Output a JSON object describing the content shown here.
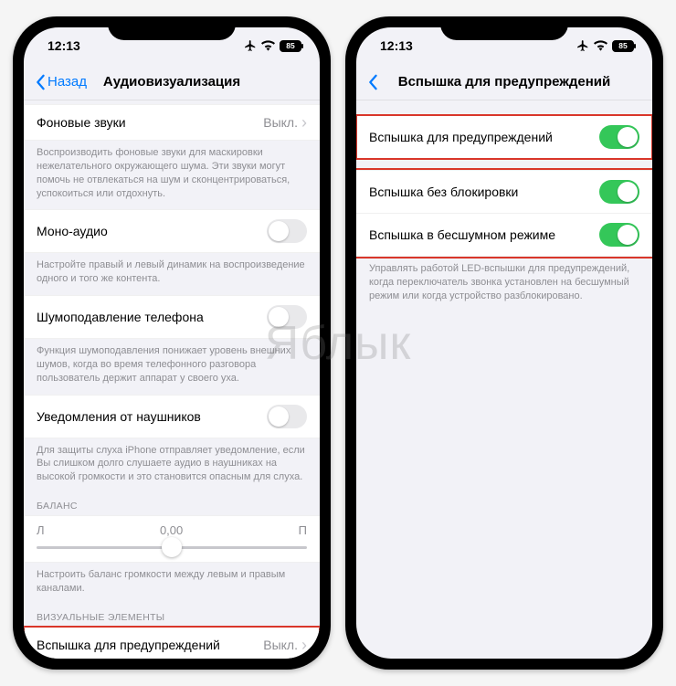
{
  "watermark": "Яблык",
  "status": {
    "time": "12:13",
    "battery": "85"
  },
  "left": {
    "back": "Назад",
    "title": "Аудиовизуализация",
    "bg_sounds": {
      "label": "Фоновые звуки",
      "value": "Выкл."
    },
    "bg_sounds_footer": "Воспроизводить фоновые звуки для маскировки нежелательного окружающего шума. Эти звуки могут помочь не отвлекаться на шум и сконцентрироваться, успокоиться или отдохнуть.",
    "mono": {
      "label": "Моно-аудио"
    },
    "mono_footer": "Настройте правый и левый динамик на воспроизведение одного и того же контента.",
    "noise": {
      "label": "Шумоподавление телефона"
    },
    "noise_footer": "Функция шумоподавления понижает уровень внешних шумов, когда во время телефонного разговора пользователь держит аппарат у своего уха.",
    "headphone": {
      "label": "Уведомления от наушников"
    },
    "headphone_footer": "Для защиты слуха iPhone отправляет уведомление, если Вы слишком долго слушаете аудио в наушниках на высокой громкости и это становится опасным для слуха.",
    "balance_header": "БАЛАНС",
    "balance": {
      "left": "Л",
      "center": "0,00",
      "right": "П"
    },
    "balance_footer": "Настроить баланс громкости между левым и правым каналами.",
    "visual_header": "ВИЗУАЛЬНЫЕ ЭЛЕМЕНТЫ",
    "flash": {
      "label": "Вспышка для предупреждений",
      "value": "Выкл."
    }
  },
  "right": {
    "title": "Вспышка для предупреждений",
    "flash_alerts": "Вспышка для предупреждений",
    "flash_unlocked": "Вспышка без блокировки",
    "flash_silent": "Вспышка в бесшумном режиме",
    "footer": "Управлять работой LED-вспышки для предупреждений, когда переключатель звонка установлен на бесшумный режим или когда устройство разблокировано."
  }
}
